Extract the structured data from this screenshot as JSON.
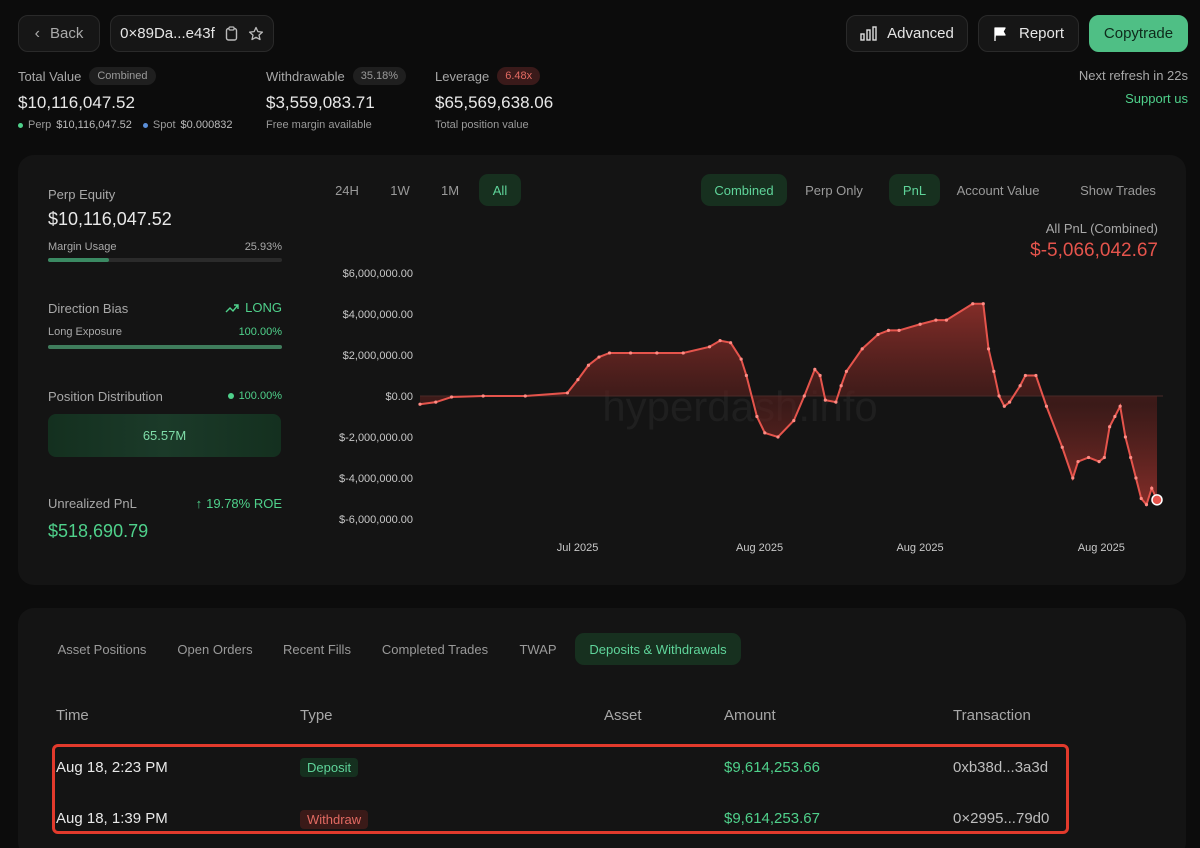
{
  "header": {
    "back_label": "Back",
    "address": "0×89Da...e43f",
    "advanced_label": "Advanced",
    "report_label": "Report",
    "copytrade_label": "Copytrade"
  },
  "summary": {
    "total_value_label": "Total Value",
    "combined_pill": "Combined",
    "total_value": "$10,116,047.52",
    "perp_label": "Perp",
    "perp_value": "$10,116,047.52",
    "spot_label": "Spot",
    "spot_value": "$0.000832",
    "withdrawable_label": "Withdrawable",
    "withdrawable_pct": "35.18%",
    "withdrawable_value": "$3,559,083.71",
    "withdrawable_sub": "Free margin available",
    "leverage_label": "Leverage",
    "leverage_pill": "6.48x",
    "leverage_value": "$65,569,638.06",
    "leverage_sub": "Total position value",
    "refresh": "Next refresh in 22s",
    "support": "Support us"
  },
  "left_panel": {
    "perp_equity_label": "Perp Equity",
    "perp_equity_value": "$10,116,047.52",
    "margin_usage_label": "Margin Usage",
    "margin_usage_pct": "25.93%",
    "margin_usage_fraction": 0.2593,
    "direction_bias_label": "Direction Bias",
    "direction_bias_value": "LONG",
    "long_exposure_label": "Long Exposure",
    "long_exposure_pct": "100.00%",
    "long_exposure_fraction": 1.0,
    "position_dist_label": "Position Distribution",
    "position_dist_pct": "100.00%",
    "position_dist_box": "65.57M",
    "unrealized_label": "Unrealized PnL",
    "roe": "19.78% ROE",
    "unrealized_value": "$518,690.79"
  },
  "chart_controls": {
    "ranges": [
      "24H",
      "1W",
      "1M",
      "All"
    ],
    "active_range": "All",
    "mode_combined": "Combined",
    "mode_perp": "Perp Only",
    "metric_pnl": "PnL",
    "metric_account": "Account Value",
    "show_trades": "Show Trades",
    "pnl_title": "All PnL (Combined)",
    "pnl_value": "$-5,066,042.67"
  },
  "chart_data": {
    "type": "area",
    "title": "All PnL (Combined)",
    "watermark": "hyperdash.info",
    "y_ticks": [
      "$6,000,000.00",
      "$4,000,000.00",
      "$2,000,000.00",
      "$0.00",
      "$-2,000,000.00",
      "$-4,000,000.00",
      "$-6,000,000.00"
    ],
    "y_tick_values": [
      6000000,
      4000000,
      2000000,
      0,
      -2000000,
      -4000000,
      -6000000
    ],
    "ylim": [
      -6000000,
      6000000
    ],
    "x_ticks": [
      "Jul 2025",
      "Aug 2025",
      "Aug 2025",
      "Aug 2025"
    ],
    "x_tick_positions": [
      0.212,
      0.457,
      0.673,
      0.917
    ],
    "series": [
      {
        "color": "#e5544c",
        "x": [
          0,
          0.03,
          0.06,
          0.12,
          0.2,
          0.28,
          0.3,
          0.32,
          0.34,
          0.36,
          0.4,
          0.45,
          0.5,
          0.55,
          0.57,
          0.59,
          0.61,
          0.62,
          0.64,
          0.655,
          0.68,
          0.71,
          0.73,
          0.75,
          0.76,
          0.77,
          0.79,
          0.8,
          0.81,
          0.84,
          0.87,
          0.89,
          0.91,
          0.95,
          0.98,
          1.0,
          1.05,
          1.07,
          1.08,
          1.09,
          1.1,
          1.11,
          1.12,
          1.14,
          1.15,
          1.17,
          1.19,
          1.22,
          1.24,
          1.25,
          1.27,
          1.29,
          1.3,
          1.31,
          1.32,
          1.33,
          1.34,
          1.35,
          1.36,
          1.37,
          1.38,
          1.39,
          1.4,
          1.41,
          1.42,
          1.43,
          1.44,
          1.45,
          1.46,
          1.47,
          1.48,
          1.49,
          1.5,
          1.51,
          1.52,
          1.53,
          1.54,
          1.55,
          1.56,
          1.57
        ],
        "y": [
          -400000,
          -300000,
          -50000,
          0,
          0,
          150000,
          800000,
          1500000,
          1900000,
          2100000,
          2100000,
          2100000,
          2100000,
          2400000,
          2700000,
          2600000,
          1800000,
          1000000,
          -1000000,
          -1800000,
          -2000000,
          -1200000,
          0,
          1300000,
          1000000,
          -200000,
          -300000,
          500000,
          1200000,
          2300000,
          3000000,
          3200000,
          3200000,
          3500000,
          3700000,
          3700000,
          4500000,
          4500000,
          2300000,
          1200000,
          0,
          -500000,
          -300000,
          500000,
          1000000,
          1000000,
          -500000,
          -2500000,
          -4000000,
          -3200000,
          -3000000,
          -3200000,
          -3000000,
          -1500000,
          -1000000,
          -500000,
          -2000000,
          -3000000,
          -4000000,
          -5000000,
          -5300000,
          -4500000,
          -5066042,
          null,
          null,
          null,
          null,
          null,
          null,
          null,
          null,
          null,
          null,
          null,
          null,
          null,
          null,
          null,
          null,
          null
        ]
      }
    ]
  },
  "bottom": {
    "tabs": [
      "Asset Positions",
      "Open Orders",
      "Recent Fills",
      "Completed Trades",
      "TWAP",
      "Deposits & Withdrawals"
    ],
    "active_tab": "Deposits & Withdrawals",
    "columns": [
      "Time",
      "Type",
      "Asset",
      "Amount",
      "Transaction"
    ],
    "rows": [
      {
        "time": "Aug 18, 2:23 PM",
        "type": "Deposit",
        "asset": "",
        "amount": "$9,614,253.66",
        "tx": "0xb38d...3a3d"
      },
      {
        "time": "Aug 18, 1:39 PM",
        "type": "Withdraw",
        "asset": "",
        "amount": "$9,614,253.67",
        "tx": "0×2995...79d0"
      }
    ]
  }
}
